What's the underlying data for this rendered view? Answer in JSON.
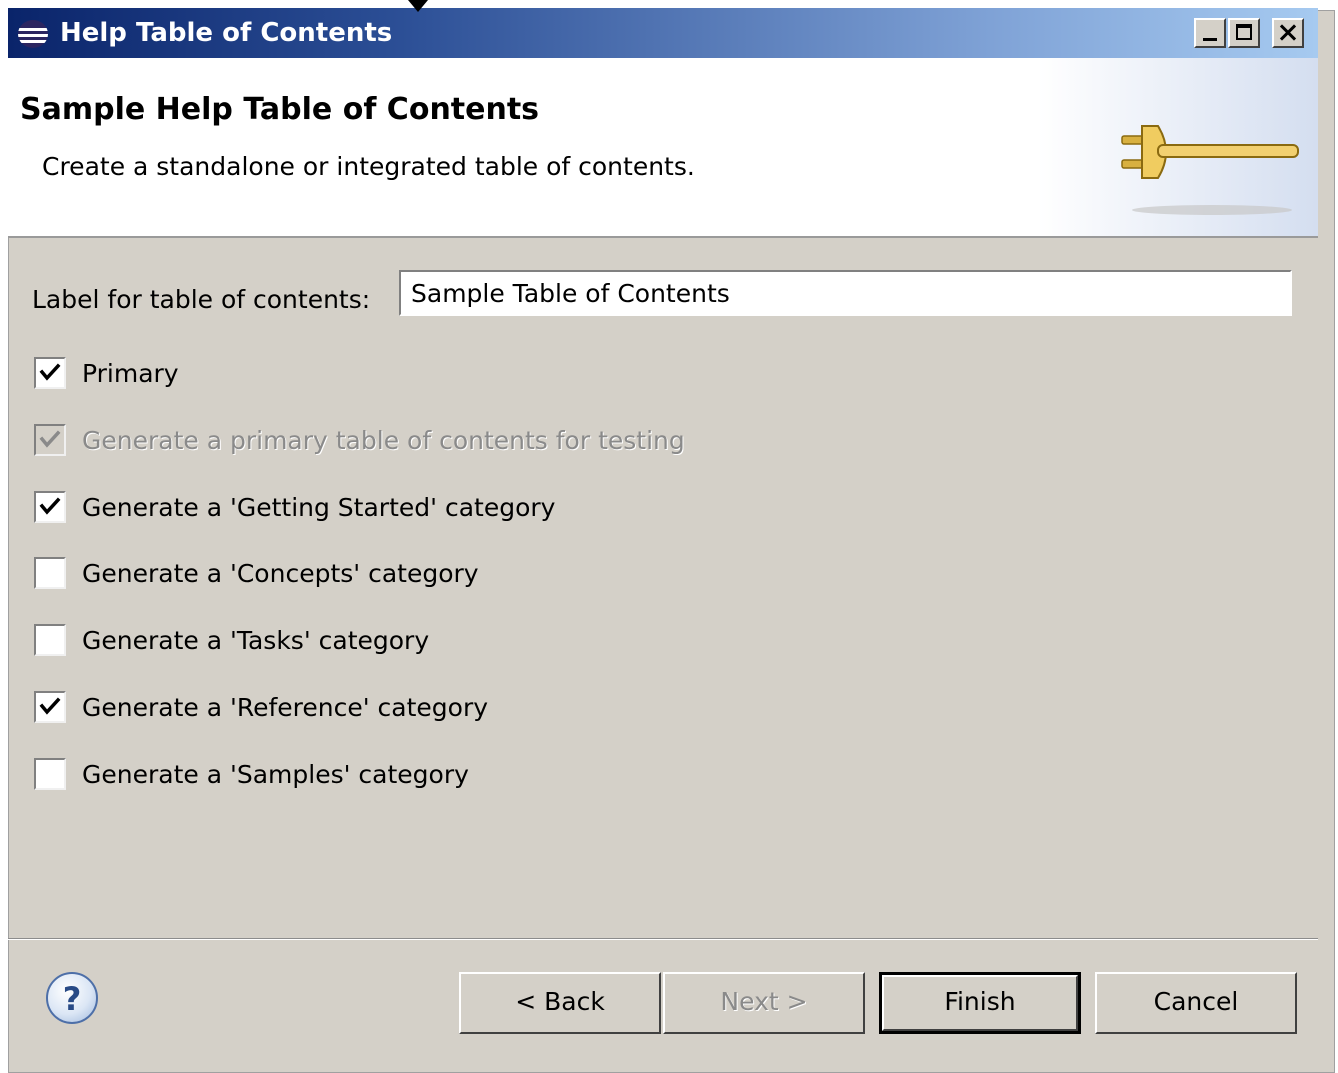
{
  "window": {
    "title": "Help Table of Contents",
    "controls": [
      "minimize-icon",
      "maximize-icon",
      "close-icon"
    ]
  },
  "header": {
    "title": "Sample Help Table of Contents",
    "description": "Create a standalone or integrated table of contents.",
    "banner_icon": "plug-icon"
  },
  "form": {
    "label": "Label for table of contents:",
    "value": "Sample Table of Contents"
  },
  "options": [
    {
      "label": "Primary",
      "checked": true,
      "enabled": true
    },
    {
      "label": "Generate a primary table of contents for testing",
      "checked": true,
      "enabled": false
    },
    {
      "label": "Generate a 'Getting Started' category",
      "checked": true,
      "enabled": true
    },
    {
      "label": "Generate a 'Concepts' category",
      "checked": false,
      "enabled": true
    },
    {
      "label": "Generate a 'Tasks' category",
      "checked": false,
      "enabled": true
    },
    {
      "label": "Generate a 'Reference' category",
      "checked": true,
      "enabled": true
    },
    {
      "label": "Generate a 'Samples' category",
      "checked": false,
      "enabled": true
    }
  ],
  "footer": {
    "help_icon": "help-icon",
    "help_glyph": "?",
    "back": "< Back",
    "next": "Next >",
    "finish": "Finish",
    "cancel": "Cancel"
  },
  "colors": {
    "titlebar_start": "#0a246a",
    "titlebar_end": "#a6caf0",
    "dialog_bg": "#d4d0c8",
    "disabled_text": "#8a8a8a"
  }
}
